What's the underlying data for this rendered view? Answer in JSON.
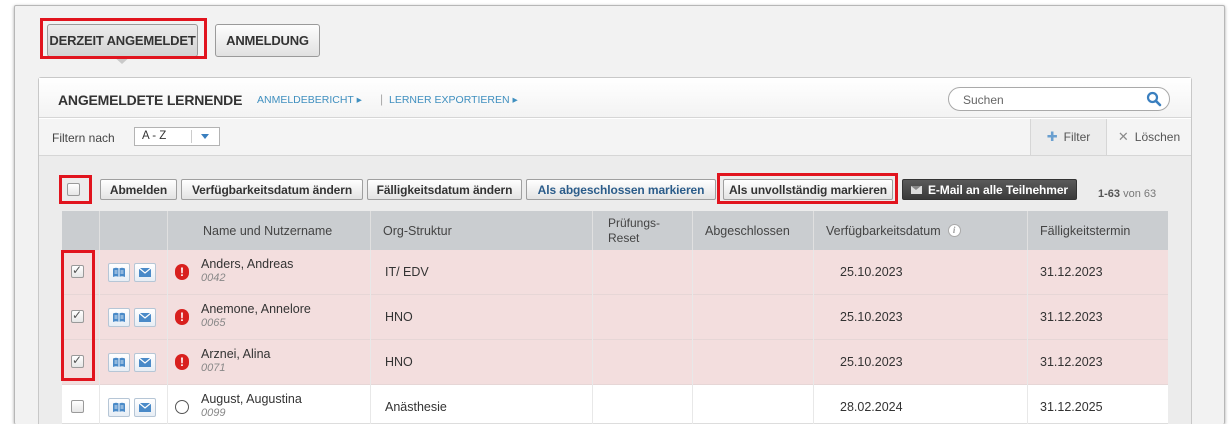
{
  "tabs": [
    {
      "label": "DERZEIT ANGEMELDET",
      "active": true
    },
    {
      "label": "ANMELDUNG",
      "active": false
    }
  ],
  "header": {
    "title": "ANGEMELDETE LERNENDE",
    "links": [
      "ANMELDEBERICHT ▸",
      "LERNER EXPORTIEREN ▸"
    ],
    "separator": "|",
    "search_placeholder": "Suchen"
  },
  "filter": {
    "label": "Filtern nach",
    "selected": "A - Z",
    "add_label": "Filter",
    "clear_label": "Löschen"
  },
  "actions": {
    "unenroll": "Abmelden",
    "change_availability": "Verfügbarkeitsdatum ändern",
    "change_due": "Fälligkeitsdatum ändern",
    "mark_complete": "Als abgeschlossen markieren",
    "mark_incomplete": "Als unvollständig markieren",
    "email_all": "E-Mail an alle Teilnehmer",
    "pager_range": "1-63",
    "pager_total": " von 63"
  },
  "table": {
    "columns": [
      "Name und Nutzername",
      "Org-Struktur",
      "Prüfungs-\nReset",
      "Abgeschlossen",
      "Verfügbarkeitsdatum",
      "Fälligkeitstermin"
    ],
    "rows": [
      {
        "name": "Anders, Andreas",
        "username": "0042",
        "org": "IT/ EDV",
        "reset": "",
        "completed": "",
        "available": "25.10.2023",
        "due": "31.12.2023",
        "checked": true,
        "status": "warning"
      },
      {
        "name": "Anemone, Annelore",
        "username": "0065",
        "org": "HNO",
        "reset": "",
        "completed": "",
        "available": "25.10.2023",
        "due": "31.12.2023",
        "checked": true,
        "status": "warning"
      },
      {
        "name": "Arznei, Alina",
        "username": "0071",
        "org": "HNO",
        "reset": "",
        "completed": "",
        "available": "25.10.2023",
        "due": "31.12.2023",
        "checked": true,
        "status": "warning"
      },
      {
        "name": "August, Augustina",
        "username": "0099",
        "org": "Anästhesie",
        "reset": "",
        "completed": "",
        "available": "28.02.2024",
        "due": "31.12.2025",
        "checked": false,
        "status": "ok"
      }
    ]
  },
  "colors": {
    "highlight": "#e1141e",
    "link": "#3f8fbf",
    "warning_row": "#f3dede",
    "warning_icon": "#d8201e"
  },
  "icons": [
    "search-icon",
    "book-icon",
    "mail-icon",
    "warning-icon",
    "info-icon",
    "plus-icon",
    "close-icon"
  ]
}
